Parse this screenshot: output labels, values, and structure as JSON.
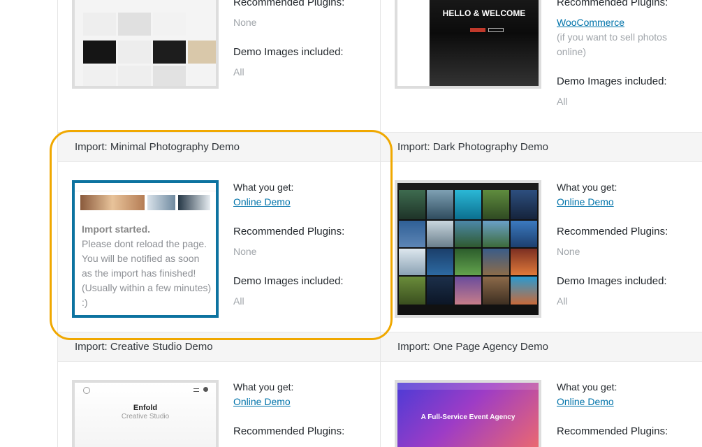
{
  "labels": {
    "what_you_get": "What you get:",
    "recommended_plugins": "Recommended Plugins:",
    "demo_images": "Demo Images included:",
    "online_demo": "Online Demo"
  },
  "top_left": {
    "plugins": "None",
    "images": "All"
  },
  "top_right": {
    "thumb_heading": "HELLO & WELCOME",
    "plugin_link": "WooCommerce",
    "plugin_note": "(if you want to sell photos online)",
    "images": "All"
  },
  "demos": [
    {
      "title": "Import: Minimal Photography Demo",
      "plugins": "None",
      "images": "All"
    },
    {
      "title": "Import: Dark Photography Demo",
      "plugins": "None",
      "images": "All"
    },
    {
      "title": "Import: Creative Studio Demo",
      "thumb_title": "Enfold",
      "thumb_sub": "Creative Studio"
    },
    {
      "title": "Import: One Page Agency Demo",
      "thumb_title": "A Full-Service Event Agency"
    }
  ],
  "import_status": {
    "heading": "Import started.",
    "message": "Please dont reload the page. You will be notified as soon as the import has finished! (Usually within a few minutes) :)"
  },
  "colors": {
    "link": "#0073aa",
    "active_border": "#0d73a0",
    "highlight": "#f0a800"
  }
}
